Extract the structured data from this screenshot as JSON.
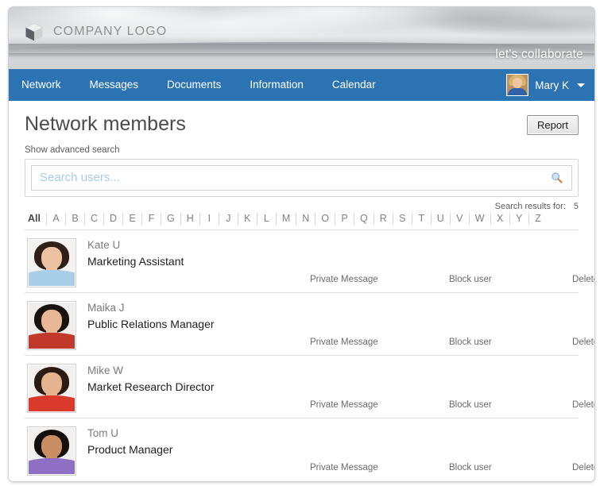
{
  "brand": {
    "logo_icon": "cube-icon",
    "logo_text": "COMPANY LOGO",
    "tagline": "let's collaborate",
    "accent_color": "#2b73b3"
  },
  "nav": {
    "items": [
      {
        "label": "Network"
      },
      {
        "label": "Messages"
      },
      {
        "label": "Documents"
      },
      {
        "label": "Information"
      },
      {
        "label": "Calendar"
      }
    ],
    "user": {
      "name": "Mary K",
      "avatar_icon": "user-avatar",
      "caret_icon": "chevron-down-icon"
    }
  },
  "page": {
    "title": "Network members",
    "report_label": "Report",
    "advanced_search_label": "Show advanced search"
  },
  "search": {
    "value": "",
    "placeholder": "Search users...",
    "icon": "search-icon",
    "results_label": "Search results for:",
    "results_count": "5"
  },
  "alphabet": {
    "active": "All",
    "items": [
      "All",
      "A",
      "B",
      "C",
      "D",
      "E",
      "F",
      "G",
      "H",
      "I",
      "J",
      "K",
      "L",
      "M",
      "N",
      "O",
      "P",
      "Q",
      "R",
      "S",
      "T",
      "U",
      "V",
      "W",
      "X",
      "Y",
      "Z"
    ]
  },
  "actions": {
    "private_message": "Private Message",
    "block_user": "Block user",
    "delete_user": "Delete user"
  },
  "members": [
    {
      "name": "Kate U",
      "role": "Marketing Assistant",
      "avatar": {
        "hair": "#2f1f16",
        "skin": "#edc2a3",
        "shirt": "#a9cfe8",
        "bg": "#f3f2f0"
      }
    },
    {
      "name": "Maika J",
      "role": "Public Relations Manager",
      "avatar": {
        "hair": "#191310",
        "skin": "#e8b795",
        "shirt": "#c0392b",
        "bg": "#efeeec"
      }
    },
    {
      "name": "Mike W",
      "role": "Market Research Director",
      "avatar": {
        "hair": "#2a1c13",
        "skin": "#e5b38e",
        "shirt": "#d93a2b",
        "bg": "#f2f1ef"
      }
    },
    {
      "name": "Tom U",
      "role": "Product Manager",
      "avatar": {
        "hair": "#140f0c",
        "skin": "#c98e61",
        "shirt": "#8f6fc4",
        "bg": "#f1f0ee"
      }
    }
  ]
}
